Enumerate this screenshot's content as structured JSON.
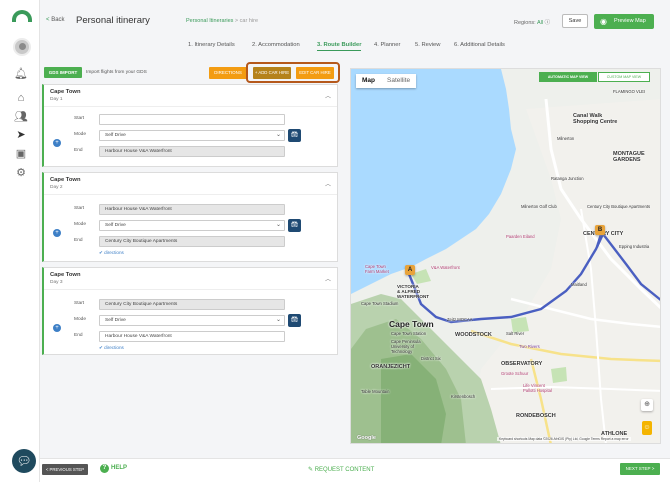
{
  "header": {
    "back_label": "Back",
    "title": "Personal itinerary",
    "breadcrumb_parent": "Personal Itineraries",
    "breadcrumb_sep": ">",
    "breadcrumb_current": "car hire",
    "regions_label": "Regions:",
    "regions_value": "All",
    "save_label": "Save",
    "preview_label": "Preview Map"
  },
  "tabs": [
    {
      "label": "1. Itinerary Details"
    },
    {
      "label": "2. Accommodation"
    },
    {
      "label": "3. Route Builder"
    },
    {
      "label": "4. Planner"
    },
    {
      "label": "5. Review"
    },
    {
      "label": "6. Additional Details"
    }
  ],
  "toolbar": {
    "gds_label": "GDS IMPORT",
    "gds_text": "Import flights from your GDS",
    "directions_label": "DIRECTIONS",
    "add_car_label": "+ ADD CAR HIRE",
    "edit_car_label": "EDIT CAR HIRE"
  },
  "labels": {
    "start": "Start",
    "mode": "Mode",
    "end": "End",
    "directions_link": "directions"
  },
  "days": [
    {
      "city": "Cape Town",
      "day": "Day 1",
      "start": "",
      "mode": "Self Drive",
      "end": "Harbour House V&A Waterfront"
    },
    {
      "city": "Cape Town",
      "day": "Day 2",
      "start": "Harbour House V&A Waterfront",
      "mode": "Self Drive",
      "end": "Century City Boutique Apartments"
    },
    {
      "city": "Cape Town",
      "day": "Day 3",
      "start": "Century City Boutique Apartments",
      "mode": "Self Drive",
      "end": "Harbour House V&A Waterfront"
    }
  ],
  "map": {
    "type_map": "Map",
    "type_satellite": "Satellite",
    "auto_view": "AUTOMATIC MAP VIEW",
    "custom_view": "CUSTOM MAP VIEW",
    "marker_a": "A",
    "marker_b": "B",
    "places": {
      "cape_town": "Cape Town",
      "century_city": "CENTURY CITY",
      "woodstock": "WOODSTOCK",
      "observatory": "OBSERVATORY",
      "oranjezicht": "ORANJEZICHT",
      "rondebosch": "RONDEBOSCH",
      "athlone": "ATHLONE",
      "montague": "MONTAGUE\nGARDENS",
      "milnerton": "Milnerton",
      "flamingo": "FLAMINGO VLEI",
      "victoria": "VICTORIA\n& ALFRED\nWATERFRONT",
      "v_and_a": "V&A Waterfront",
      "century_city_apts": "Century City Boutique Apartments",
      "canal_walk": "Canal Walk\nShopping Centre",
      "ratanga": "Ratanga Junction",
      "milnerton_golf": "Milnerton Golf Club",
      "paarden": "Paarden Eiland",
      "cput": "Cape Peninsula\nUniversity of\nTechnology",
      "district6": "District Six",
      "two_rivers": "Two Rivers",
      "groote": "Groote Schuur",
      "lifevincent": "Life Vincent\nPallotti Hospital",
      "kirstenbosch": "Kirstenbosch",
      "epping": "Epping Industria",
      "maitland": "Maitland",
      "cape_farm": "Cape Town\nFarm Market",
      "zeitz": "Zeitz MOCAA",
      "cape_town_stadium": "Cape Town Stadium",
      "table_mountain": "Table Mountain",
      "cape_town_station": "Cape Town Station",
      "salt_river": "Salt River"
    },
    "attribution": "Keyboard shortcuts   Map data ©2026 AfriGIS (Pty) Ltd, Google   Terms   Report a map error",
    "google": "Google"
  },
  "footer": {
    "prev_label": "< PREVIOUS STEP",
    "help_label": "HELP",
    "request_label": "REQUEST CONTENT",
    "next_label": "NEXT STEP >"
  },
  "colors": {
    "brand_green": "#4caf50",
    "orange": "#f39c12",
    "highlight": "#b5581b",
    "route": "#4a5fc1"
  },
  "icons": {
    "rail": [
      "logo-icon",
      "bell-icon",
      "home-icon",
      "users-icon",
      "send-icon",
      "image-icon",
      "gear-icon",
      "chat-icon"
    ]
  }
}
